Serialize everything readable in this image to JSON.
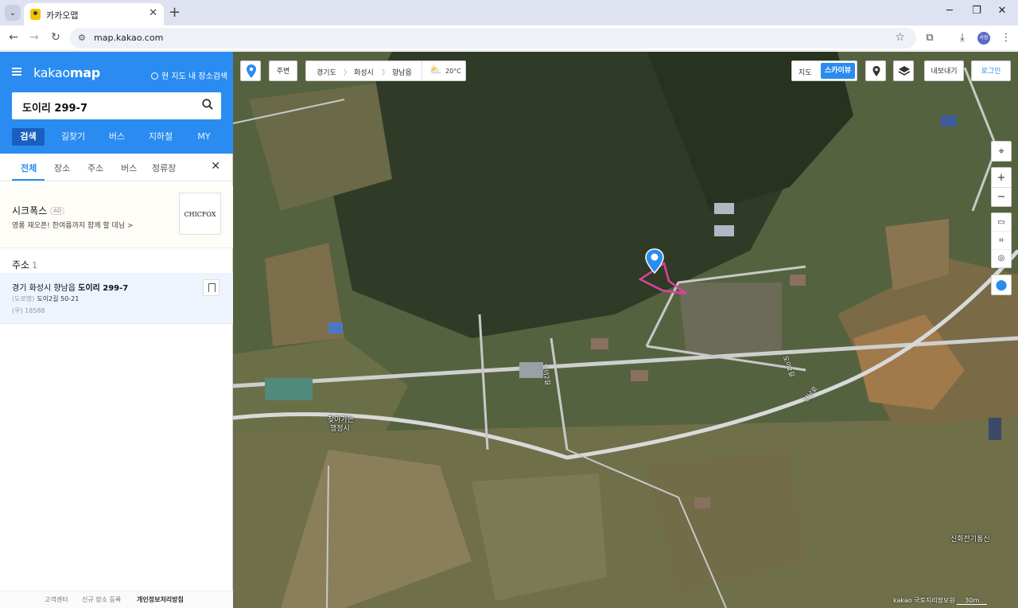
{
  "browser": {
    "tab_title": "카카오맵",
    "url": "map.kakao.com",
    "profile_label": "사람"
  },
  "sidebar": {
    "logo_light": "kakao",
    "logo_bold": "map",
    "in_map_search": "현 지도 내 장소검색",
    "search_value": "도이리 299-7",
    "main_tabs": [
      "검색",
      "길찾기",
      "버스",
      "지하철",
      "MY"
    ],
    "sub_tabs": [
      "전체",
      "장소",
      "주소",
      "버스",
      "정류장"
    ],
    "ad": {
      "title": "시크폭스",
      "badge": "AD",
      "desc": "영롱 재오픈! 한여름까지 함께 할 데님 >",
      "logo_text": "CHICFOX"
    },
    "address_section": {
      "heading": "주소",
      "count": "1",
      "item": {
        "prefix": "경기 화성시 향남읍",
        "bold": "도이리 299-7",
        "road_label": "(도로명)",
        "road": "도이2길 50-21",
        "zip": "(우) 18588"
      }
    },
    "footer": [
      "고객센터",
      "신규 장소 등록",
      "개인정보처리방침"
    ]
  },
  "map": {
    "near_button": "주변",
    "region": [
      "경기도",
      "화성시",
      "향남읍"
    ],
    "weather": "20°C",
    "maptype_map": "지도",
    "maptype_sky": "스카이뷰",
    "export_button": "내보내기",
    "login_button": "로그인",
    "labels": {
      "civic_center": "찾아가는",
      "civic_center_2": "행정시",
      "shop": "신화전기통신",
      "road_1": "도이2길",
      "road_2": "향남로",
      "road_3": "도이2길"
    },
    "copyright": "kakao 국토지리정보원",
    "scale": "30m"
  }
}
